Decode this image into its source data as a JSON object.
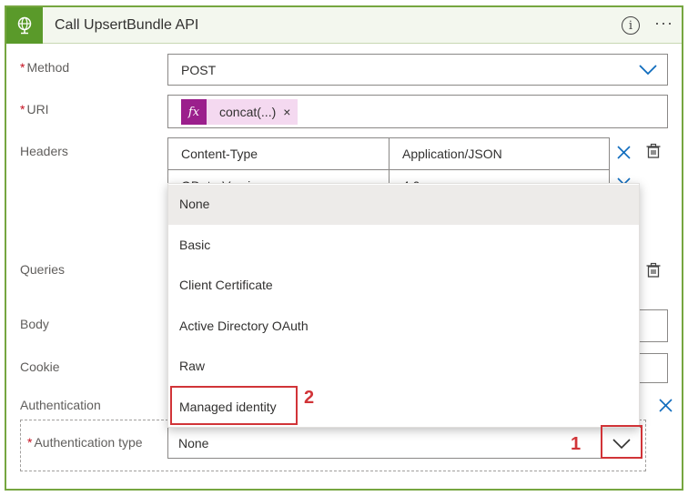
{
  "header": {
    "title": "Call UpsertBundle API",
    "icon": "globe-icon",
    "accent": "#5a9a2a"
  },
  "method": {
    "label": "Method",
    "required_mark": "*",
    "value": "POST"
  },
  "uri": {
    "label": "URI",
    "required_mark": "*",
    "token_icon": "fx",
    "token_label": "concat(...)",
    "token_remove": "×"
  },
  "headers": {
    "label": "Headers",
    "rows": [
      {
        "key": "Content-Type",
        "value": "Application/JSON"
      },
      {
        "key": "OData-Version",
        "value": "4.0"
      }
    ]
  },
  "queries": {
    "label": "Queries"
  },
  "body": {
    "label": "Body"
  },
  "cookie": {
    "label": "Cookie"
  },
  "authentication": {
    "label": "Authentication",
    "type_label": "Authentication type",
    "required_mark": "*",
    "type_value": "None",
    "options": [
      "None",
      "Basic",
      "Client Certificate",
      "Active Directory OAuth",
      "Raw",
      "Managed identity"
    ],
    "selected_option": "None"
  },
  "annotations": {
    "step1": "1",
    "step2": "2",
    "color": "#d13438"
  }
}
